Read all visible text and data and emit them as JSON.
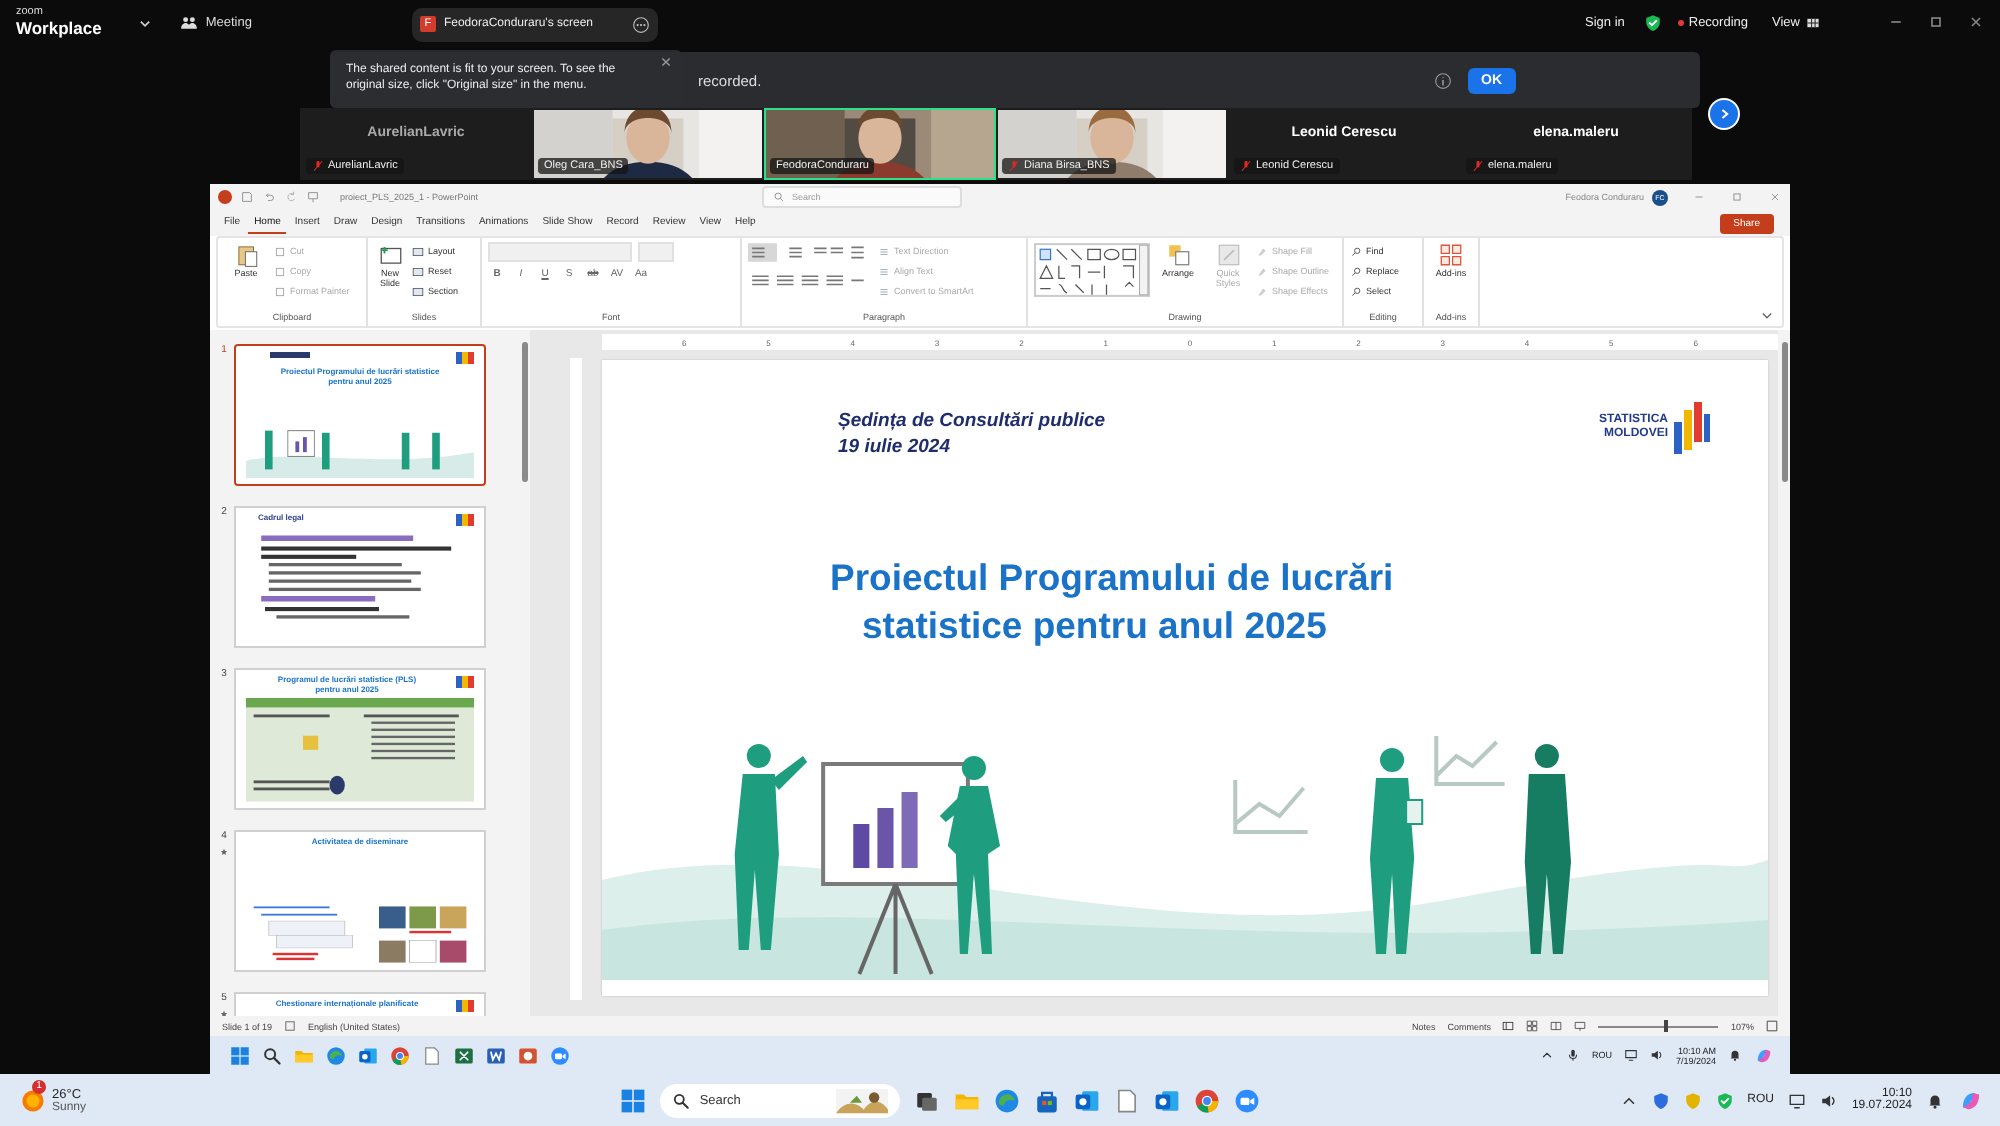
{
  "zoom_bar": {
    "brand_small": "zoom",
    "brand": "Workplace",
    "meeting": "Meeting",
    "share_initial": "F",
    "share_label": "FeodoraConduraru's screen",
    "sign_in": "Sign in",
    "recording": "Recording",
    "view": "View"
  },
  "banner": {
    "text": "recorded.",
    "ok": "OK"
  },
  "tooltip": {
    "text": "The shared content is fit to your screen. To see the original size, click \"Original size\" in the menu."
  },
  "participants": [
    {
      "name": "AurelianLavric",
      "kind": "name",
      "center": "AurelianLavric",
      "muted": true,
      "speaking": false
    },
    {
      "name": "Oleg Cara_BNS",
      "kind": "video",
      "muted": false,
      "speaking": false
    },
    {
      "name": "FeodoraConduraru",
      "kind": "video",
      "muted": false,
      "speaking": true
    },
    {
      "name": "Diana Birsa_BNS",
      "kind": "video",
      "muted": true,
      "speaking": false
    },
    {
      "name": "Leonid Cerescu",
      "kind": "name",
      "center": "Leonid Cerescu",
      "muted": true,
      "speaking": false
    },
    {
      "name": "elena.maleru",
      "kind": "name",
      "center": "elena.maleru",
      "muted": true,
      "speaking": false
    }
  ],
  "powerpoint": {
    "title": "proiect_PLS_2025_1 - PowerPoint",
    "search": "Search",
    "user": "Feodora Conduraru",
    "avatar": "FC",
    "share": "Share",
    "tabs": [
      {
        "label": "File",
        "selected": false
      },
      {
        "label": "Home",
        "selected": true
      },
      {
        "label": "Insert",
        "selected": false
      },
      {
        "label": "Draw",
        "selected": false
      },
      {
        "label": "Design",
        "selected": false
      },
      {
        "label": "Transitions",
        "selected": false
      },
      {
        "label": "Animations",
        "selected": false
      },
      {
        "label": "Slide Show",
        "selected": false
      },
      {
        "label": "Record",
        "selected": false
      },
      {
        "label": "Review",
        "selected": false
      },
      {
        "label": "View",
        "selected": false
      },
      {
        "label": "Help",
        "selected": false
      }
    ],
    "ribbon": [
      {
        "kind": "clipboard",
        "label": "Clipboard",
        "large": "Paste",
        "items": [
          {
            "label": "Cut",
            "disabled": true
          },
          {
            "label": "Copy",
            "disabled": true
          },
          {
            "label": "Format Painter",
            "disabled": true
          }
        ]
      },
      {
        "kind": "slides",
        "label": "Slides",
        "large": "New Slide",
        "items": [
          {
            "label": "Layout",
            "disabled": false
          },
          {
            "label": "Reset",
            "disabled": false
          },
          {
            "label": "Section",
            "disabled": false
          }
        ]
      },
      {
        "kind": "font",
        "label": "Font",
        "glyphs": [
          "B",
          "I",
          "U",
          "S",
          "ab",
          "AV",
          "Aa"
        ]
      },
      {
        "kind": "paragraph",
        "label": "Paragraph",
        "items": [
          {
            "label": "Text Direction",
            "disabled": true
          },
          {
            "label": "Align Text",
            "disabled": true
          },
          {
            "label": "Convert to SmartArt",
            "disabled": true
          }
        ]
      },
      {
        "kind": "drawing",
        "label": "Drawing",
        "large": "Arrange",
        "large2": "Quick Styles",
        "items": [
          {
            "label": "Shape Fill",
            "disabled": true
          },
          {
            "label": "Shape Outline",
            "disabled": true
          },
          {
            "label": "Shape Effects",
            "disabled": true
          }
        ]
      },
      {
        "kind": "editing",
        "label": "Editing",
        "items": [
          {
            "label": "Find",
            "disabled": false
          },
          {
            "label": "Replace",
            "disabled": false
          },
          {
            "label": "Select",
            "disabled": false
          }
        ]
      },
      {
        "kind": "addins",
        "label": "Add-ins",
        "large": "Add-ins"
      }
    ],
    "thumbnails": [
      {
        "number": "1",
        "title": "Proiectul Programului de lucrări statistice pentru anul 2025",
        "kind": "title",
        "selected": true,
        "transition": false
      },
      {
        "number": "2",
        "title": "Cadrul legal",
        "kind": "text",
        "selected": false,
        "transition": false
      },
      {
        "number": "3",
        "title": "Programul de lucrări statistice (PLS) pentru anul 2025",
        "kind": "table",
        "selected": false,
        "transition": false
      },
      {
        "number": "4",
        "title": "Activitatea de diseminare",
        "kind": "images",
        "selected": false,
        "transition": true
      },
      {
        "number": "5",
        "title": "Chestionare internaționale planificate",
        "kind": "partial",
        "selected": false,
        "transition": true
      }
    ],
    "ruler": [
      "6",
      "5",
      "4",
      "3",
      "2",
      "1",
      "0",
      "1",
      "2",
      "3",
      "4",
      "5",
      "6"
    ],
    "slide": {
      "heading": "Ședința de Consultări publice",
      "date": "19 iulie 2024",
      "logo_top": "STATISTICA",
      "logo_bottom": "MOLDOVEI",
      "title_1": "Proiectul Programului de lucrări",
      "title_2": "statistice pentru anul 2025"
    },
    "status": {
      "slide": "Slide 1 of 19",
      "language": "English (United States)",
      "notes": "Notes",
      "comments": "Comments",
      "zoom_slider": {
        "level": 0.55
      },
      "zoom": "107%"
    },
    "taskbar": {
      "lang": "ROU",
      "time": "10:10 AM",
      "date": "7/19/2024"
    }
  },
  "taskbar": {
    "badge": "1",
    "temp": "26°C",
    "weather": "Sunny",
    "search": "Search",
    "lang": "ROU",
    "time": "10:10",
    "date": "19.07.2024"
  }
}
